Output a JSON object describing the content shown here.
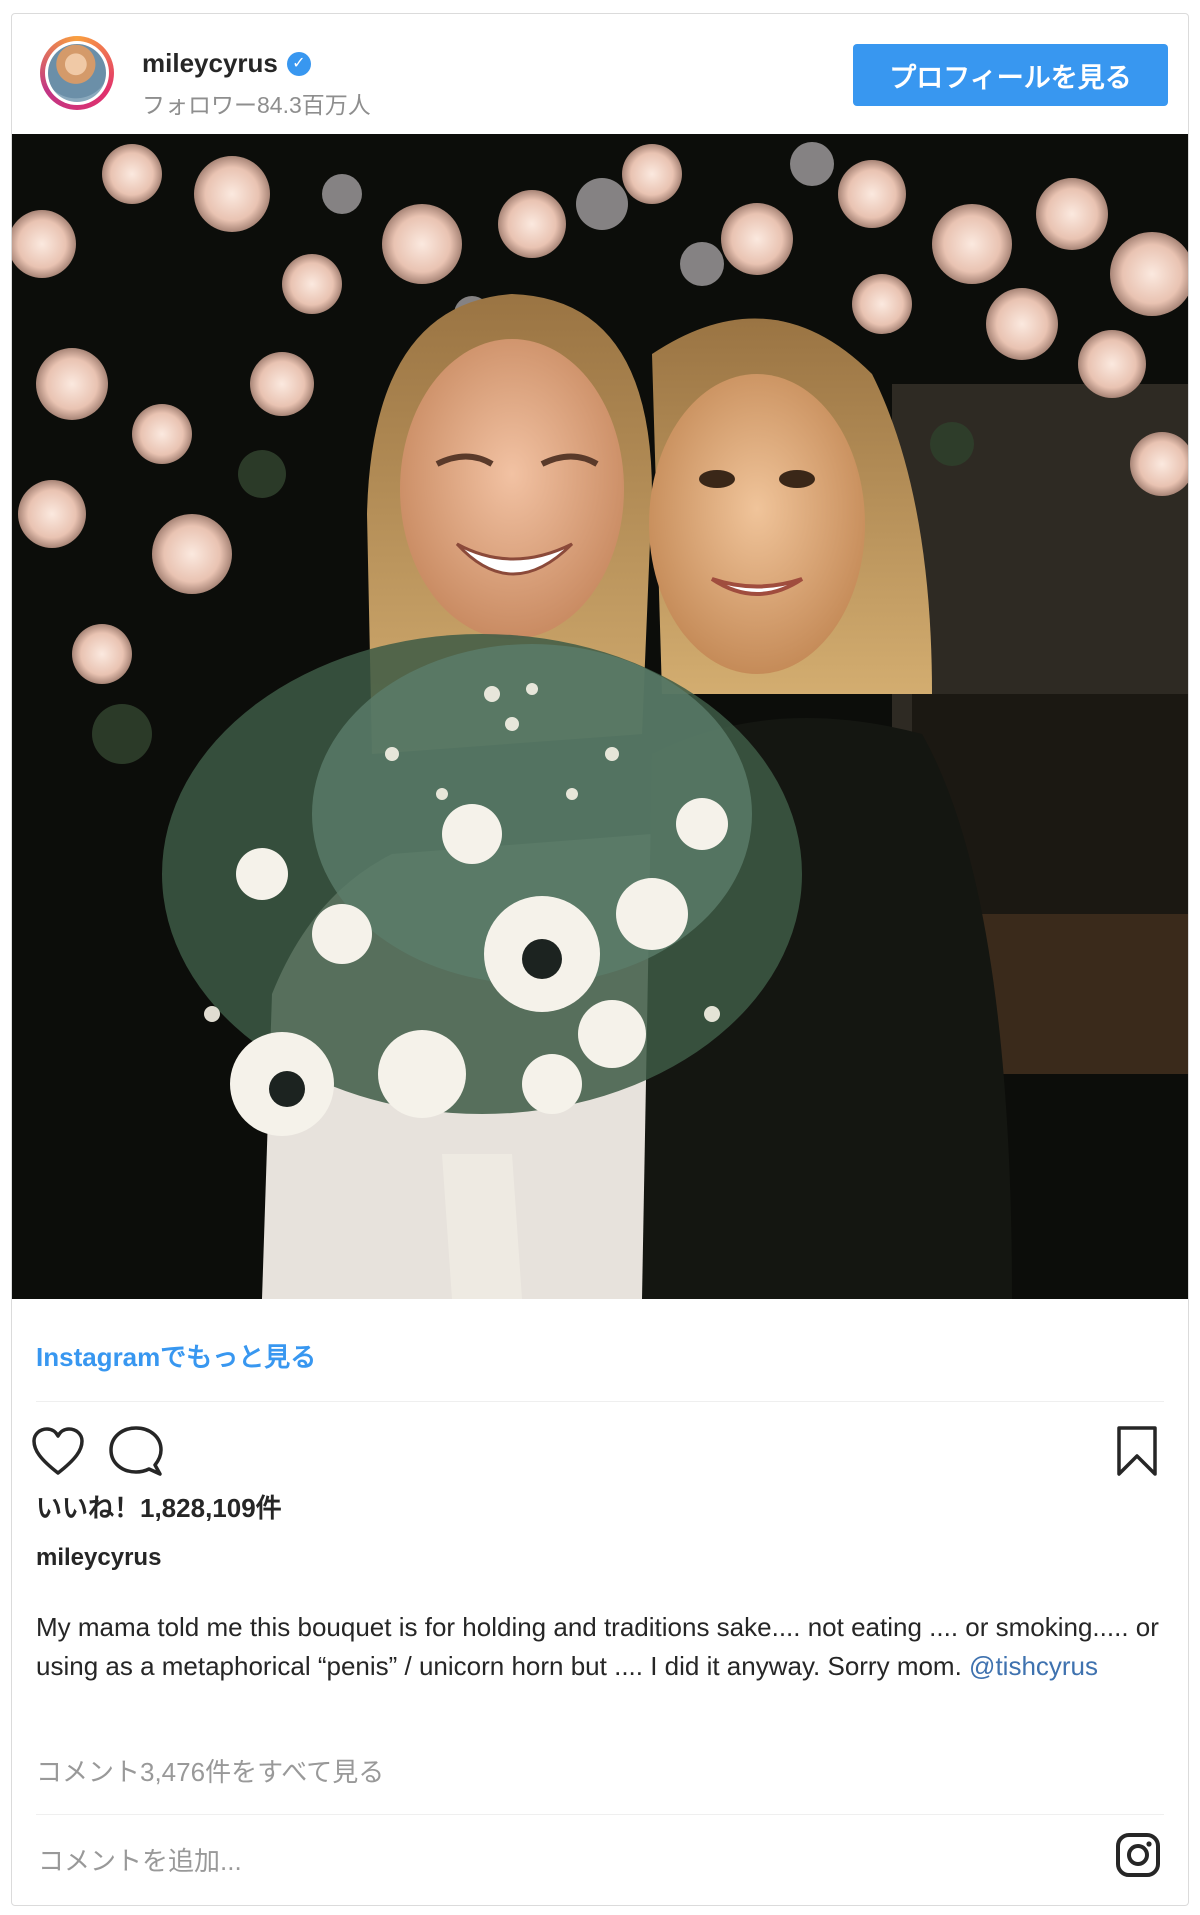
{
  "header": {
    "username": "mileycyrus",
    "verified_mark": "✓",
    "followers": "フォロワー84.3百万人",
    "profile_button": "プロフィールを見る"
  },
  "post": {
    "image_alt": "",
    "more_link": "Instagramでもっと見る",
    "likes": "いいね！1,828,109件",
    "caption_user": "mileycyrus",
    "caption_text": "My mama told me this bouquet is for holding and traditions sake.... not eating .... or smoking..... or using as a metaphorical “penis” / unicorn horn but .... I did it anyway. Sorry mom. ",
    "caption_mention": "@tishcyrus",
    "view_comments": "コメント3,476件をすべて見る",
    "add_comment_placeholder": "コメントを追加..."
  },
  "icons": {
    "like": "heart-icon",
    "comment": "comment-icon",
    "save": "bookmark-icon",
    "instagram": "instagram-logo-icon"
  },
  "colors": {
    "accent": "#3897f0",
    "text": "#262626",
    "muted": "#8e8e8e"
  }
}
